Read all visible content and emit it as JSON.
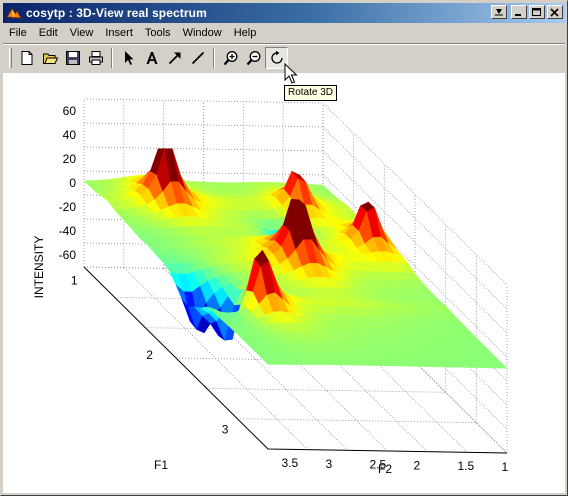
{
  "window": {
    "title": "cosytp : 3D-View real spectrum",
    "icons": {
      "app": "matlab-icon",
      "dock": "dock-icon",
      "minimize": "minimize-icon",
      "maximize": "maximize-icon",
      "close": "close-icon"
    }
  },
  "menu": {
    "items": [
      "File",
      "Edit",
      "View",
      "Insert",
      "Tools",
      "Window",
      "Help"
    ]
  },
  "toolbar": {
    "buttons": [
      {
        "name": "new-figure",
        "icon": "new-file-icon"
      },
      {
        "name": "open-file",
        "icon": "open-folder-icon"
      },
      {
        "name": "save",
        "icon": "save-icon"
      },
      {
        "name": "print",
        "icon": "print-icon"
      },
      {
        "name": "edit-plot",
        "icon": "pointer-arrow-icon"
      },
      {
        "name": "insert-text",
        "icon": "text-a-icon"
      },
      {
        "name": "insert-arrow",
        "icon": "arrow-icon"
      },
      {
        "name": "insert-line",
        "icon": "line-icon"
      },
      {
        "name": "zoom-in",
        "icon": "zoom-in-icon"
      },
      {
        "name": "zoom-out",
        "icon": "zoom-out-icon"
      },
      {
        "name": "rotate-3d",
        "icon": "rotate-3d-icon",
        "active": true
      }
    ],
    "tooltip": "Rotate 3D"
  },
  "plot": {
    "zlabel": "INTENSITY",
    "xlabel": "F1",
    "ylabel": "F2",
    "z_ticks": [
      "60",
      "40",
      "20",
      "0",
      "-20",
      "-40",
      "-60"
    ],
    "f1_ticks": [
      "1",
      "2",
      "3"
    ],
    "f2_ticks": [
      "1",
      "1.5",
      "2",
      "2.5",
      "3",
      "3.5"
    ],
    "colormap": "jet"
  }
}
